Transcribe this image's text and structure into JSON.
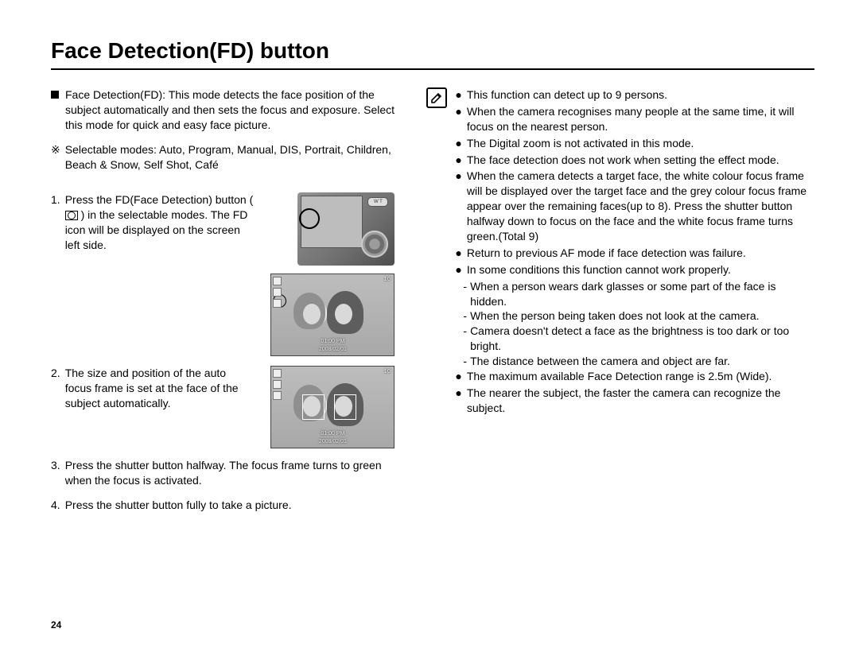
{
  "page": {
    "title": "Face Detection(FD) button",
    "number": "24"
  },
  "left": {
    "intro_label": "Face Detection(FD):",
    "intro_body": "This mode detects the face position of the subject automatically and then sets the focus and exposure. Select this mode for quick and easy face picture.",
    "modes_marker": "※",
    "modes_label": "Selectable modes:",
    "modes_body": "Auto, Program, Manual, DIS, Portrait, Children, Beach & Snow, Self Shot, Café",
    "step1_marker": "1.",
    "step1_a": "Press the FD(Face Detection) button (",
    "step1_b": ") in the selectable modes. The FD icon will be displayed on the screen left side.",
    "step2_marker": "2.",
    "step2": "The size and position of the auto focus frame is set at the face of the subject automatically.",
    "step3_marker": "3.",
    "step3": "Press the shutter button halfway. The focus frame turns to green when the focus is activated.",
    "step4_marker": "4.",
    "step4": "Press the shutter button fully to take a picture.",
    "lcd": {
      "top_right_count": "10",
      "time": "01:00 PM",
      "date": "2008/02/01",
      "zoom_labels": "W     T"
    }
  },
  "right": {
    "b1": "This function can detect up to 9 persons.",
    "b2": "When the camera recognises many people at the same time, it will focus on the nearest person.",
    "b3": "The Digital zoom is not activated in this mode.",
    "b4": "The face detection does not work when setting the effect mode.",
    "b5": "When the camera detects a target face, the white colour focus frame will be displayed over the target face and the grey colour focus frame appear over the remaining faces(up to 8). Press the shutter button halfway down to focus on the face and the white focus frame turns green.(Total 9)",
    "b6": "Return to previous AF mode if face detection was failure.",
    "b7": "In some conditions this function cannot work properly.",
    "s1": "When a person wears dark glasses or some part of the face is hidden.",
    "s2": "When the person being taken does not look at the camera.",
    "s3": "Camera doesn't detect a face as the brightness is too dark or too bright.",
    "s4": "The distance between the camera and object are far.",
    "b8": "The maximum available Face Detection range is 2.5m (Wide).",
    "b9": "The nearer the subject, the faster the camera can recognize the subject."
  }
}
